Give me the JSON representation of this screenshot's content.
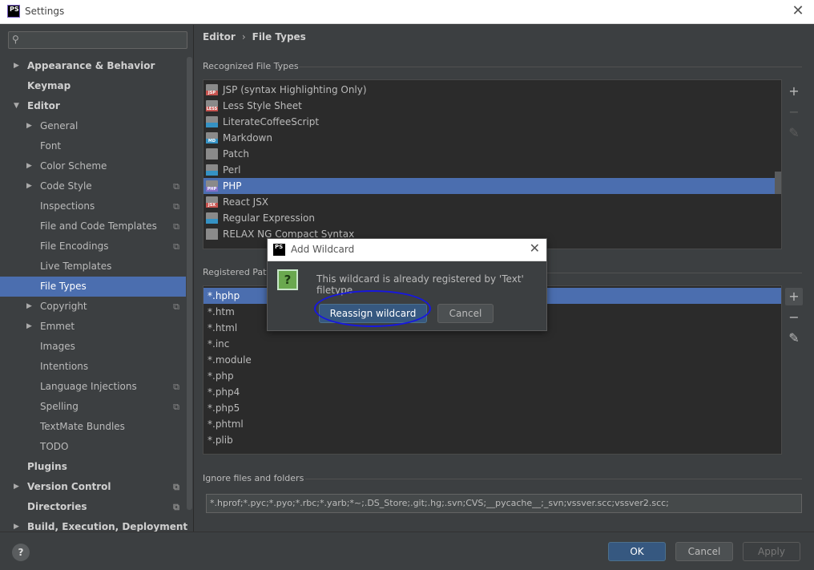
{
  "window": {
    "title": "Settings",
    "logo": "PS"
  },
  "search": {
    "placeholder": ""
  },
  "sidebar": {
    "items": [
      {
        "label": "Appearance & Behavior",
        "level": 0,
        "bold": true,
        "arrow": "collapsed",
        "cfg": false,
        "selected": false
      },
      {
        "label": "Keymap",
        "level": 0,
        "bold": true,
        "arrow": "none",
        "cfg": false,
        "selected": false
      },
      {
        "label": "Editor",
        "level": 0,
        "bold": true,
        "arrow": "expanded",
        "cfg": false,
        "selected": false
      },
      {
        "label": "General",
        "level": 1,
        "bold": false,
        "arrow": "collapsed",
        "cfg": false,
        "selected": false
      },
      {
        "label": "Font",
        "level": 1,
        "bold": false,
        "arrow": "none",
        "cfg": false,
        "selected": false
      },
      {
        "label": "Color Scheme",
        "level": 1,
        "bold": false,
        "arrow": "collapsed",
        "cfg": false,
        "selected": false
      },
      {
        "label": "Code Style",
        "level": 1,
        "bold": false,
        "arrow": "collapsed",
        "cfg": true,
        "selected": false
      },
      {
        "label": "Inspections",
        "level": 1,
        "bold": false,
        "arrow": "none",
        "cfg": true,
        "selected": false
      },
      {
        "label": "File and Code Templates",
        "level": 1,
        "bold": false,
        "arrow": "none",
        "cfg": true,
        "selected": false
      },
      {
        "label": "File Encodings",
        "level": 1,
        "bold": false,
        "arrow": "none",
        "cfg": true,
        "selected": false
      },
      {
        "label": "Live Templates",
        "level": 1,
        "bold": false,
        "arrow": "none",
        "cfg": false,
        "selected": false
      },
      {
        "label": "File Types",
        "level": 1,
        "bold": false,
        "arrow": "none",
        "cfg": false,
        "selected": true
      },
      {
        "label": "Copyright",
        "level": 1,
        "bold": false,
        "arrow": "collapsed",
        "cfg": true,
        "selected": false
      },
      {
        "label": "Emmet",
        "level": 1,
        "bold": false,
        "arrow": "collapsed",
        "cfg": false,
        "selected": false
      },
      {
        "label": "Images",
        "level": 1,
        "bold": false,
        "arrow": "none",
        "cfg": false,
        "selected": false
      },
      {
        "label": "Intentions",
        "level": 1,
        "bold": false,
        "arrow": "none",
        "cfg": false,
        "selected": false
      },
      {
        "label": "Language Injections",
        "level": 1,
        "bold": false,
        "arrow": "none",
        "cfg": true,
        "selected": false
      },
      {
        "label": "Spelling",
        "level": 1,
        "bold": false,
        "arrow": "none",
        "cfg": true,
        "selected": false
      },
      {
        "label": "TextMate Bundles",
        "level": 1,
        "bold": false,
        "arrow": "none",
        "cfg": false,
        "selected": false
      },
      {
        "label": "TODO",
        "level": 1,
        "bold": false,
        "arrow": "none",
        "cfg": false,
        "selected": false
      },
      {
        "label": "Plugins",
        "level": 0,
        "bold": true,
        "arrow": "none",
        "cfg": false,
        "selected": false
      },
      {
        "label": "Version Control",
        "level": 0,
        "bold": true,
        "arrow": "collapsed",
        "cfg": true,
        "selected": false
      },
      {
        "label": "Directories",
        "level": 0,
        "bold": true,
        "arrow": "none",
        "cfg": true,
        "selected": false
      },
      {
        "label": "Build, Execution, Deployment",
        "level": 0,
        "bold": true,
        "arrow": "collapsed",
        "cfg": false,
        "selected": false
      }
    ]
  },
  "breadcrumb": {
    "parent": "Editor",
    "separator": "›",
    "current": "File Types"
  },
  "recognized": {
    "label": "Recognized File Types",
    "rows": [
      {
        "label": "JSP (syntax Highlighting Only)",
        "icon": "jsp-file-icon",
        "icon_text": "JSP",
        "icon_color": "#c75450",
        "selected": false
      },
      {
        "label": "Less Style Sheet",
        "icon": "less-file-icon",
        "icon_text": "LESS",
        "icon_color": "#c75450",
        "selected": false
      },
      {
        "label": "LiterateCoffeeScript",
        "icon": "coffee-file-icon",
        "icon_text": "",
        "icon_color": "#3592c4",
        "selected": false
      },
      {
        "label": "Markdown",
        "icon": "markdown-file-icon",
        "icon_text": "MD",
        "icon_color": "#3592c4",
        "selected": false
      },
      {
        "label": "Patch",
        "icon": "patch-file-icon",
        "icon_text": "",
        "icon_color": "#8a8a8a",
        "selected": false
      },
      {
        "label": "Perl",
        "icon": "perl-file-icon",
        "icon_text": "",
        "icon_color": "#3592c4",
        "selected": false
      },
      {
        "label": "PHP",
        "icon": "php-file-icon",
        "icon_text": "PHP",
        "icon_color": "#8470c8",
        "selected": true
      },
      {
        "label": "React JSX",
        "icon": "jsx-file-icon",
        "icon_text": "JSX",
        "icon_color": "#c75450",
        "selected": false
      },
      {
        "label": "Regular Expression",
        "icon": "regex-file-icon",
        "icon_text": "",
        "icon_color": "#3592c4",
        "selected": false
      },
      {
        "label": "RELAX NG Compact Syntax",
        "icon": "rnc-file-icon",
        "icon_text": "",
        "icon_color": "#8a8a8a",
        "selected": false
      }
    ],
    "add_glyph": "+",
    "remove_glyph": "−",
    "edit_glyph": "✎"
  },
  "patterns": {
    "label": "Registered Patterns",
    "rows": [
      "*.hphp",
      "*.htm",
      "*.html",
      "*.inc",
      "*.module",
      "*.php",
      "*.php4",
      "*.php5",
      "*.phtml",
      "*.plib"
    ],
    "selected_index": 0,
    "add_glyph": "+",
    "remove_glyph": "−",
    "edit_glyph": "✎"
  },
  "ignore": {
    "label": "Ignore files and folders",
    "value": "*.hprof;*.pyc;*.pyo;*.rbc;*.yarb;*~;.DS_Store;.git;.hg;.svn;CVS;__pycache__;_svn;vssver.scc;vssver2.scc;"
  },
  "dialog": {
    "title": "Add Wildcard",
    "logo": "PS",
    "close_glyph": "✕",
    "question_glyph": "?",
    "message": "This wildcard is already registered by 'Text' filetype",
    "reassign_label": "Reassign wildcard",
    "cancel_label": "Cancel"
  },
  "footer": {
    "help_glyph": "?",
    "ok_label": "OK",
    "cancel_label": "Cancel",
    "apply_label": "Apply"
  },
  "colors": {
    "selection": "#4b6eaf",
    "panel": "#3c3f41",
    "list_bg": "#2b2b2b",
    "annotation_ring": "#1717e0"
  }
}
